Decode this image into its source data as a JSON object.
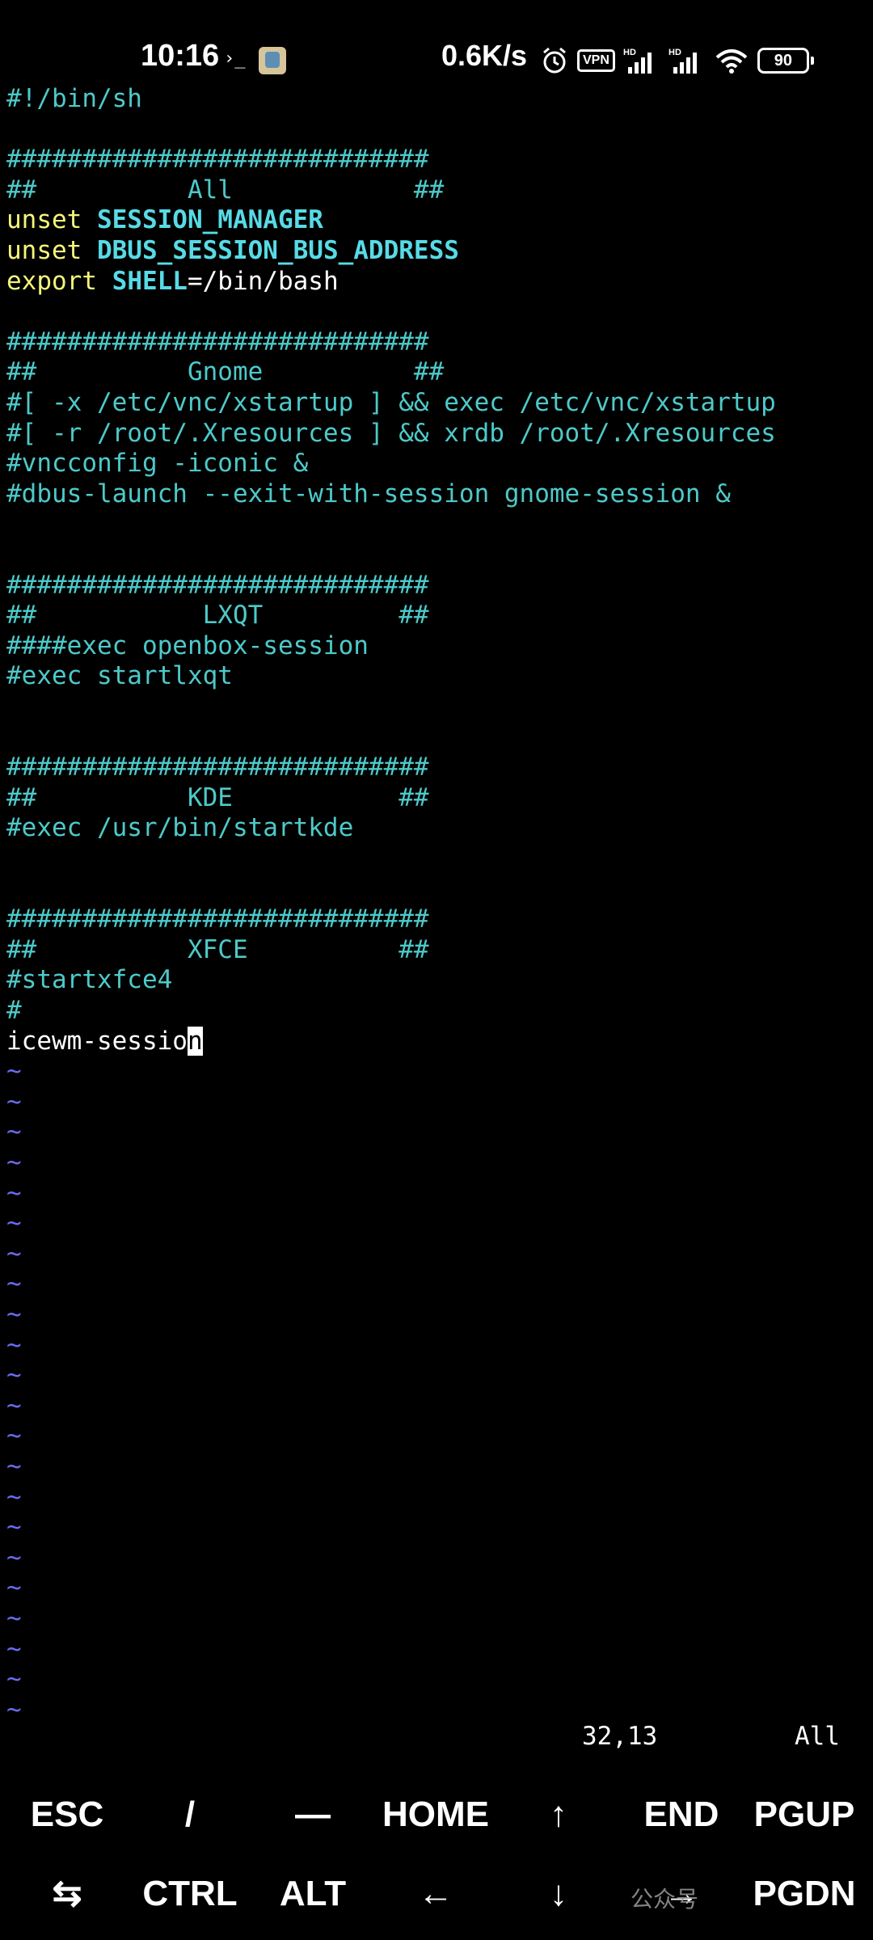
{
  "status_bar": {
    "time": "10:16",
    "terminal_glyph": "›_",
    "net_speed": "0.6K/s",
    "vpn_label": "VPN",
    "battery": "90",
    "icons": [
      "alarm-icon",
      "vpn-icon",
      "hd-signal-1-icon",
      "hd-signal-2-icon",
      "wifi-icon",
      "battery-icon"
    ]
  },
  "editor": {
    "lines": [
      [
        {
          "t": "#!/bin/sh",
          "c": "c"
        }
      ],
      [],
      [
        {
          "t": "############################",
          "c": "c"
        }
      ],
      [
        {
          "t": "##          All            ##",
          "c": "c"
        }
      ],
      [
        {
          "t": "unset ",
          "c": "y"
        },
        {
          "t": "SESSION_MANAGER",
          "c": "b"
        }
      ],
      [
        {
          "t": "unset ",
          "c": "y"
        },
        {
          "t": "DBUS_SESSION_BUS_ADDRESS",
          "c": "b"
        }
      ],
      [
        {
          "t": "export ",
          "c": "y"
        },
        {
          "t": "SHELL",
          "c": "b"
        },
        {
          "t": "=/bin/bash",
          "c": "w"
        }
      ],
      [],
      [
        {
          "t": "############################",
          "c": "c"
        }
      ],
      [
        {
          "t": "##          Gnome          ##",
          "c": "c"
        }
      ],
      [
        {
          "t": "#[ -x /etc/vnc/xstartup ] && exec /etc/vnc/xstartup",
          "c": "c"
        }
      ],
      [
        {
          "t": "#[ -r /root/.Xresources ] && xrdb /root/.Xresources",
          "c": "c"
        }
      ],
      [
        {
          "t": "#vncconfig -iconic &",
          "c": "c"
        }
      ],
      [
        {
          "t": "#dbus-launch --exit-with-session gnome-session &",
          "c": "c"
        }
      ],
      [],
      [],
      [
        {
          "t": "############################",
          "c": "c"
        }
      ],
      [
        {
          "t": "##           LXQT         ##",
          "c": "c"
        }
      ],
      [
        {
          "t": "####exec openbox-session",
          "c": "c"
        }
      ],
      [
        {
          "t": "#exec startlxqt",
          "c": "c"
        }
      ],
      [],
      [],
      [
        {
          "t": "############################",
          "c": "c"
        }
      ],
      [
        {
          "t": "##          KDE           ##",
          "c": "c"
        }
      ],
      [
        {
          "t": "#exec /usr/bin/startkde",
          "c": "c"
        }
      ],
      [],
      [],
      [
        {
          "t": "############################",
          "c": "c"
        }
      ],
      [
        {
          "t": "##          XFCE          ##",
          "c": "c"
        }
      ],
      [
        {
          "t": "#startxfce4",
          "c": "c"
        }
      ],
      [
        {
          "t": "#",
          "c": "c"
        }
      ],
      [
        {
          "t": "icewm-sessio",
          "c": "w"
        },
        {
          "t": "n",
          "c": "cursor"
        }
      ]
    ],
    "empty_line_marker": "~",
    "empty_line_count": 22
  },
  "vim_status": {
    "position": "32,13",
    "scope": "All"
  },
  "extra_keys": {
    "row1": [
      "ESC",
      "/",
      "—",
      "HOME",
      "↑",
      "END",
      "PGUP"
    ],
    "row2": [
      "⇆",
      "CTRL",
      "ALT",
      "←",
      "↓",
      "→",
      "PGDN"
    ]
  },
  "watermark": "公众号"
}
